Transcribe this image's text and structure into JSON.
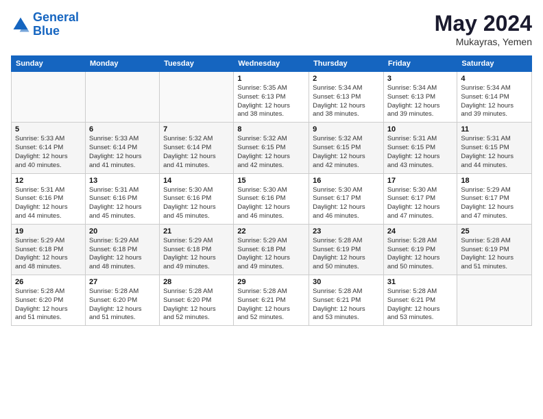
{
  "logo": {
    "line1": "General",
    "line2": "Blue"
  },
  "title": "May 2024",
  "location": "Mukayras, Yemen",
  "days_header": [
    "Sunday",
    "Monday",
    "Tuesday",
    "Wednesday",
    "Thursday",
    "Friday",
    "Saturday"
  ],
  "weeks": [
    [
      {
        "num": "",
        "info": ""
      },
      {
        "num": "",
        "info": ""
      },
      {
        "num": "",
        "info": ""
      },
      {
        "num": "1",
        "info": "Sunrise: 5:35 AM\nSunset: 6:13 PM\nDaylight: 12 hours\nand 38 minutes."
      },
      {
        "num": "2",
        "info": "Sunrise: 5:34 AM\nSunset: 6:13 PM\nDaylight: 12 hours\nand 38 minutes."
      },
      {
        "num": "3",
        "info": "Sunrise: 5:34 AM\nSunset: 6:13 PM\nDaylight: 12 hours\nand 39 minutes."
      },
      {
        "num": "4",
        "info": "Sunrise: 5:34 AM\nSunset: 6:14 PM\nDaylight: 12 hours\nand 39 minutes."
      }
    ],
    [
      {
        "num": "5",
        "info": "Sunrise: 5:33 AM\nSunset: 6:14 PM\nDaylight: 12 hours\nand 40 minutes."
      },
      {
        "num": "6",
        "info": "Sunrise: 5:33 AM\nSunset: 6:14 PM\nDaylight: 12 hours\nand 41 minutes."
      },
      {
        "num": "7",
        "info": "Sunrise: 5:32 AM\nSunset: 6:14 PM\nDaylight: 12 hours\nand 41 minutes."
      },
      {
        "num": "8",
        "info": "Sunrise: 5:32 AM\nSunset: 6:15 PM\nDaylight: 12 hours\nand 42 minutes."
      },
      {
        "num": "9",
        "info": "Sunrise: 5:32 AM\nSunset: 6:15 PM\nDaylight: 12 hours\nand 42 minutes."
      },
      {
        "num": "10",
        "info": "Sunrise: 5:31 AM\nSunset: 6:15 PM\nDaylight: 12 hours\nand 43 minutes."
      },
      {
        "num": "11",
        "info": "Sunrise: 5:31 AM\nSunset: 6:15 PM\nDaylight: 12 hours\nand 44 minutes."
      }
    ],
    [
      {
        "num": "12",
        "info": "Sunrise: 5:31 AM\nSunset: 6:16 PM\nDaylight: 12 hours\nand 44 minutes."
      },
      {
        "num": "13",
        "info": "Sunrise: 5:31 AM\nSunset: 6:16 PM\nDaylight: 12 hours\nand 45 minutes."
      },
      {
        "num": "14",
        "info": "Sunrise: 5:30 AM\nSunset: 6:16 PM\nDaylight: 12 hours\nand 45 minutes."
      },
      {
        "num": "15",
        "info": "Sunrise: 5:30 AM\nSunset: 6:16 PM\nDaylight: 12 hours\nand 46 minutes."
      },
      {
        "num": "16",
        "info": "Sunrise: 5:30 AM\nSunset: 6:17 PM\nDaylight: 12 hours\nand 46 minutes."
      },
      {
        "num": "17",
        "info": "Sunrise: 5:30 AM\nSunset: 6:17 PM\nDaylight: 12 hours\nand 47 minutes."
      },
      {
        "num": "18",
        "info": "Sunrise: 5:29 AM\nSunset: 6:17 PM\nDaylight: 12 hours\nand 47 minutes."
      }
    ],
    [
      {
        "num": "19",
        "info": "Sunrise: 5:29 AM\nSunset: 6:18 PM\nDaylight: 12 hours\nand 48 minutes."
      },
      {
        "num": "20",
        "info": "Sunrise: 5:29 AM\nSunset: 6:18 PM\nDaylight: 12 hours\nand 48 minutes."
      },
      {
        "num": "21",
        "info": "Sunrise: 5:29 AM\nSunset: 6:18 PM\nDaylight: 12 hours\nand 49 minutes."
      },
      {
        "num": "22",
        "info": "Sunrise: 5:29 AM\nSunset: 6:18 PM\nDaylight: 12 hours\nand 49 minutes."
      },
      {
        "num": "23",
        "info": "Sunrise: 5:28 AM\nSunset: 6:19 PM\nDaylight: 12 hours\nand 50 minutes."
      },
      {
        "num": "24",
        "info": "Sunrise: 5:28 AM\nSunset: 6:19 PM\nDaylight: 12 hours\nand 50 minutes."
      },
      {
        "num": "25",
        "info": "Sunrise: 5:28 AM\nSunset: 6:19 PM\nDaylight: 12 hours\nand 51 minutes."
      }
    ],
    [
      {
        "num": "26",
        "info": "Sunrise: 5:28 AM\nSunset: 6:20 PM\nDaylight: 12 hours\nand 51 minutes."
      },
      {
        "num": "27",
        "info": "Sunrise: 5:28 AM\nSunset: 6:20 PM\nDaylight: 12 hours\nand 51 minutes."
      },
      {
        "num": "28",
        "info": "Sunrise: 5:28 AM\nSunset: 6:20 PM\nDaylight: 12 hours\nand 52 minutes."
      },
      {
        "num": "29",
        "info": "Sunrise: 5:28 AM\nSunset: 6:21 PM\nDaylight: 12 hours\nand 52 minutes."
      },
      {
        "num": "30",
        "info": "Sunrise: 5:28 AM\nSunset: 6:21 PM\nDaylight: 12 hours\nand 53 minutes."
      },
      {
        "num": "31",
        "info": "Sunrise: 5:28 AM\nSunset: 6:21 PM\nDaylight: 12 hours\nand 53 minutes."
      },
      {
        "num": "",
        "info": ""
      }
    ]
  ]
}
